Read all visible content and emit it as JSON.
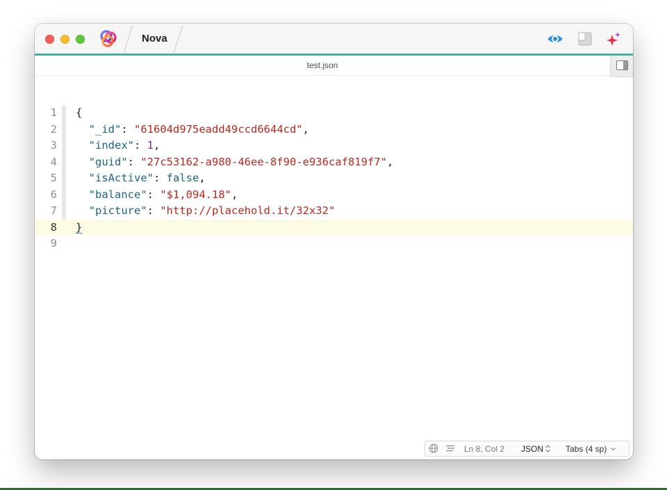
{
  "app": {
    "title": "Nova"
  },
  "tab": {
    "filename": "test.json"
  },
  "editor": {
    "lines": [
      {
        "number": "1",
        "tokens": [
          {
            "t": "punc",
            "v": "{"
          }
        ]
      },
      {
        "number": "2",
        "tokens": [
          {
            "t": "punc",
            "v": "  "
          },
          {
            "t": "key",
            "v": "\"_id\""
          },
          {
            "t": "punc",
            "v": ": "
          },
          {
            "t": "str",
            "v": "\"61604d975eadd49ccd6644cd\""
          },
          {
            "t": "punc",
            "v": ","
          }
        ]
      },
      {
        "number": "3",
        "tokens": [
          {
            "t": "punc",
            "v": "  "
          },
          {
            "t": "key",
            "v": "\"index\""
          },
          {
            "t": "punc",
            "v": ": "
          },
          {
            "t": "num",
            "v": "1"
          },
          {
            "t": "punc",
            "v": ","
          }
        ]
      },
      {
        "number": "4",
        "tokens": [
          {
            "t": "punc",
            "v": "  "
          },
          {
            "t": "key",
            "v": "\"guid\""
          },
          {
            "t": "punc",
            "v": ": "
          },
          {
            "t": "str",
            "v": "\"27c53162-a980-46ee-8f90-e936caf819f7\""
          },
          {
            "t": "punc",
            "v": ","
          }
        ]
      },
      {
        "number": "5",
        "tokens": [
          {
            "t": "punc",
            "v": "  "
          },
          {
            "t": "key",
            "v": "\"isActive\""
          },
          {
            "t": "punc",
            "v": ": "
          },
          {
            "t": "kw",
            "v": "false"
          },
          {
            "t": "punc",
            "v": ","
          }
        ]
      },
      {
        "number": "6",
        "tokens": [
          {
            "t": "punc",
            "v": "  "
          },
          {
            "t": "key",
            "v": "\"balance\""
          },
          {
            "t": "punc",
            "v": ": "
          },
          {
            "t": "str",
            "v": "\"$1,094.18\""
          },
          {
            "t": "punc",
            "v": ","
          }
        ]
      },
      {
        "number": "7",
        "tokens": [
          {
            "t": "punc",
            "v": "  "
          },
          {
            "t": "key",
            "v": "\"picture\""
          },
          {
            "t": "punc",
            "v": ": "
          },
          {
            "t": "str",
            "v": "\"http://placehold.it/32x32\""
          }
        ]
      },
      {
        "number": "8",
        "current": true,
        "tokens": [
          {
            "t": "brace-u",
            "v": "}"
          }
        ]
      },
      {
        "number": "9",
        "tokens": []
      }
    ]
  },
  "statusbar": {
    "position": "Ln 8, Col 2",
    "language": "JSON",
    "indentation": "Tabs (4 sp)"
  },
  "colors": {
    "accent_line": "#3fb3a2",
    "key": "#1a6587",
    "string": "#b52a1d",
    "number": "#8c2b94",
    "current_line": "#fdfbe3"
  },
  "icons": {
    "titlebar": [
      "nova-logo-icon",
      "eye-icon",
      "layout-icon",
      "sparkle-icon"
    ],
    "tabbar": [
      "sidebar-toggle-icon"
    ],
    "statusbar": [
      "globe-icon",
      "lines-icon",
      "chevron-updown-icon",
      "chevron-down-icon"
    ]
  }
}
